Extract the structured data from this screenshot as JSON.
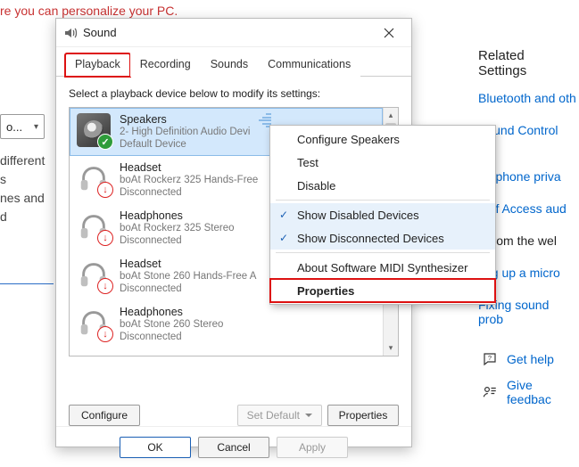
{
  "background": {
    "top_text": "re you can personalize your PC.",
    "dropdown_value": "o...",
    "para_line1": "different s",
    "para_line2": "nes and d"
  },
  "sidebar": {
    "heading": "Related Settings",
    "links": {
      "bluetooth": "Bluetooth and oth",
      "sound_cp": "Sound Control Pa",
      "mic_privacy": "crophone priva",
      "ease_audio": "e of Access aud"
    },
    "plain": {
      "web": "p from the wel",
      "mic_setup": "ting up a micro",
      "fix_sound": "Fixing sound prob"
    },
    "help": "Get help",
    "feedback": "Give feedbac"
  },
  "dialog": {
    "title": "Sound",
    "tabs": {
      "playback": "Playback",
      "recording": "Recording",
      "sounds": "Sounds",
      "comms": "Communications"
    },
    "instruction": "Select a playback device below to modify its settings:",
    "devices": [
      {
        "name": "Speakers",
        "sub1": "2- High Definition Audio Devi",
        "sub2": "Default Device",
        "status": "ok",
        "selected": true,
        "kind": "speaker"
      },
      {
        "name": "Headset",
        "sub1": "boAt Rockerz 325 Hands-Free",
        "sub2": "Disconnected",
        "status": "down",
        "selected": false,
        "kind": "headset"
      },
      {
        "name": "Headphones",
        "sub1": "boAt Rockerz 325 Stereo",
        "sub2": "Disconnected",
        "status": "down",
        "selected": false,
        "kind": "headphones"
      },
      {
        "name": "Headset",
        "sub1": "boAt Stone 260 Hands-Free A",
        "sub2": "Disconnected",
        "status": "down",
        "selected": false,
        "kind": "headset"
      },
      {
        "name": "Headphones",
        "sub1": "boAt Stone 260 Stereo",
        "sub2": "Disconnected",
        "status": "down",
        "selected": false,
        "kind": "headphones"
      }
    ],
    "buttons": {
      "configure": "Configure",
      "set_default": "Set Default",
      "properties": "Properties",
      "ok": "OK",
      "cancel": "Cancel",
      "apply": "Apply"
    }
  },
  "context_menu": {
    "items": {
      "configure": "Configure Speakers",
      "test": "Test",
      "disable": "Disable",
      "show_disabled": "Show Disabled Devices",
      "show_disconnected": "Show Disconnected Devices",
      "about_midi": "About Software MIDI Synthesizer",
      "properties": "Properties"
    }
  },
  "colors": {
    "accent": "#0066cc",
    "hl": "#d11",
    "sel_bg": "#d3e8fc"
  }
}
